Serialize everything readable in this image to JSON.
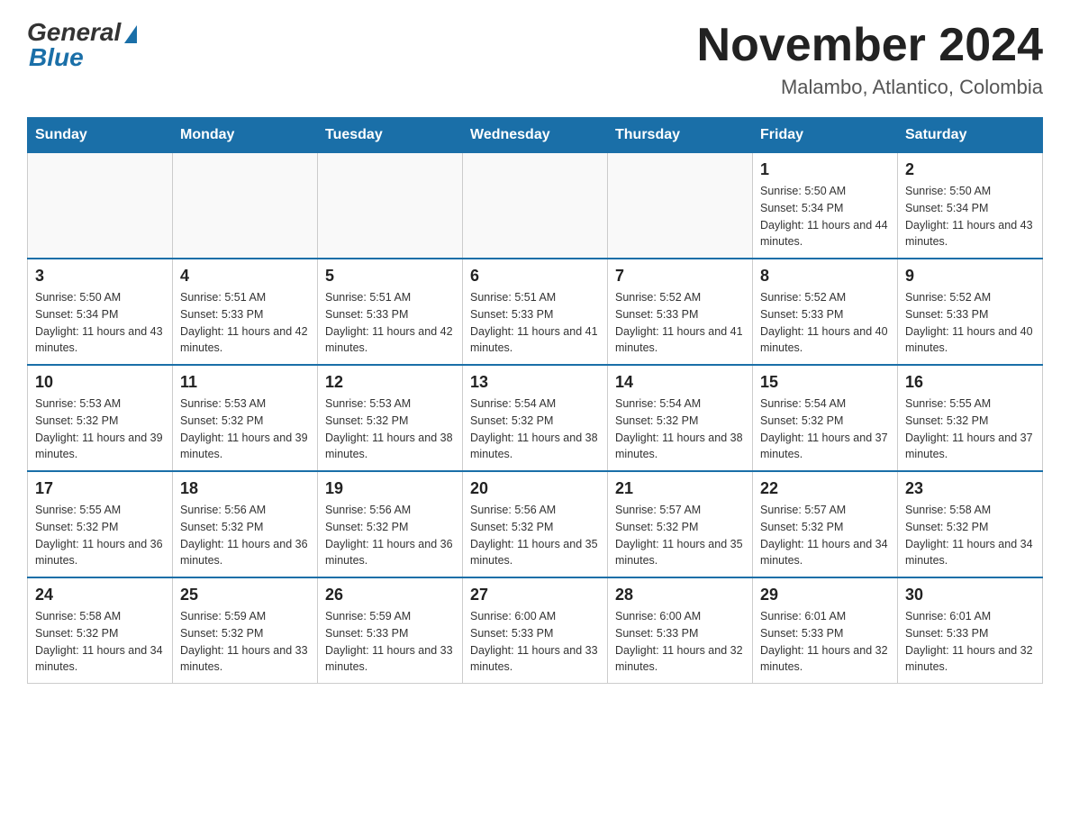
{
  "header": {
    "logo_general": "General",
    "logo_blue": "Blue",
    "month_title": "November 2024",
    "location": "Malambo, Atlantico, Colombia"
  },
  "days_of_week": [
    "Sunday",
    "Monday",
    "Tuesday",
    "Wednesday",
    "Thursday",
    "Friday",
    "Saturday"
  ],
  "weeks": [
    [
      {
        "day": "",
        "info": ""
      },
      {
        "day": "",
        "info": ""
      },
      {
        "day": "",
        "info": ""
      },
      {
        "day": "",
        "info": ""
      },
      {
        "day": "",
        "info": ""
      },
      {
        "day": "1",
        "info": "Sunrise: 5:50 AM\nSunset: 5:34 PM\nDaylight: 11 hours and 44 minutes."
      },
      {
        "day": "2",
        "info": "Sunrise: 5:50 AM\nSunset: 5:34 PM\nDaylight: 11 hours and 43 minutes."
      }
    ],
    [
      {
        "day": "3",
        "info": "Sunrise: 5:50 AM\nSunset: 5:34 PM\nDaylight: 11 hours and 43 minutes."
      },
      {
        "day": "4",
        "info": "Sunrise: 5:51 AM\nSunset: 5:33 PM\nDaylight: 11 hours and 42 minutes."
      },
      {
        "day": "5",
        "info": "Sunrise: 5:51 AM\nSunset: 5:33 PM\nDaylight: 11 hours and 42 minutes."
      },
      {
        "day": "6",
        "info": "Sunrise: 5:51 AM\nSunset: 5:33 PM\nDaylight: 11 hours and 41 minutes."
      },
      {
        "day": "7",
        "info": "Sunrise: 5:52 AM\nSunset: 5:33 PM\nDaylight: 11 hours and 41 minutes."
      },
      {
        "day": "8",
        "info": "Sunrise: 5:52 AM\nSunset: 5:33 PM\nDaylight: 11 hours and 40 minutes."
      },
      {
        "day": "9",
        "info": "Sunrise: 5:52 AM\nSunset: 5:33 PM\nDaylight: 11 hours and 40 minutes."
      }
    ],
    [
      {
        "day": "10",
        "info": "Sunrise: 5:53 AM\nSunset: 5:32 PM\nDaylight: 11 hours and 39 minutes."
      },
      {
        "day": "11",
        "info": "Sunrise: 5:53 AM\nSunset: 5:32 PM\nDaylight: 11 hours and 39 minutes."
      },
      {
        "day": "12",
        "info": "Sunrise: 5:53 AM\nSunset: 5:32 PM\nDaylight: 11 hours and 38 minutes."
      },
      {
        "day": "13",
        "info": "Sunrise: 5:54 AM\nSunset: 5:32 PM\nDaylight: 11 hours and 38 minutes."
      },
      {
        "day": "14",
        "info": "Sunrise: 5:54 AM\nSunset: 5:32 PM\nDaylight: 11 hours and 38 minutes."
      },
      {
        "day": "15",
        "info": "Sunrise: 5:54 AM\nSunset: 5:32 PM\nDaylight: 11 hours and 37 minutes."
      },
      {
        "day": "16",
        "info": "Sunrise: 5:55 AM\nSunset: 5:32 PM\nDaylight: 11 hours and 37 minutes."
      }
    ],
    [
      {
        "day": "17",
        "info": "Sunrise: 5:55 AM\nSunset: 5:32 PM\nDaylight: 11 hours and 36 minutes."
      },
      {
        "day": "18",
        "info": "Sunrise: 5:56 AM\nSunset: 5:32 PM\nDaylight: 11 hours and 36 minutes."
      },
      {
        "day": "19",
        "info": "Sunrise: 5:56 AM\nSunset: 5:32 PM\nDaylight: 11 hours and 36 minutes."
      },
      {
        "day": "20",
        "info": "Sunrise: 5:56 AM\nSunset: 5:32 PM\nDaylight: 11 hours and 35 minutes."
      },
      {
        "day": "21",
        "info": "Sunrise: 5:57 AM\nSunset: 5:32 PM\nDaylight: 11 hours and 35 minutes."
      },
      {
        "day": "22",
        "info": "Sunrise: 5:57 AM\nSunset: 5:32 PM\nDaylight: 11 hours and 34 minutes."
      },
      {
        "day": "23",
        "info": "Sunrise: 5:58 AM\nSunset: 5:32 PM\nDaylight: 11 hours and 34 minutes."
      }
    ],
    [
      {
        "day": "24",
        "info": "Sunrise: 5:58 AM\nSunset: 5:32 PM\nDaylight: 11 hours and 34 minutes."
      },
      {
        "day": "25",
        "info": "Sunrise: 5:59 AM\nSunset: 5:32 PM\nDaylight: 11 hours and 33 minutes."
      },
      {
        "day": "26",
        "info": "Sunrise: 5:59 AM\nSunset: 5:33 PM\nDaylight: 11 hours and 33 minutes."
      },
      {
        "day": "27",
        "info": "Sunrise: 6:00 AM\nSunset: 5:33 PM\nDaylight: 11 hours and 33 minutes."
      },
      {
        "day": "28",
        "info": "Sunrise: 6:00 AM\nSunset: 5:33 PM\nDaylight: 11 hours and 32 minutes."
      },
      {
        "day": "29",
        "info": "Sunrise: 6:01 AM\nSunset: 5:33 PM\nDaylight: 11 hours and 32 minutes."
      },
      {
        "day": "30",
        "info": "Sunrise: 6:01 AM\nSunset: 5:33 PM\nDaylight: 11 hours and 32 minutes."
      }
    ]
  ]
}
